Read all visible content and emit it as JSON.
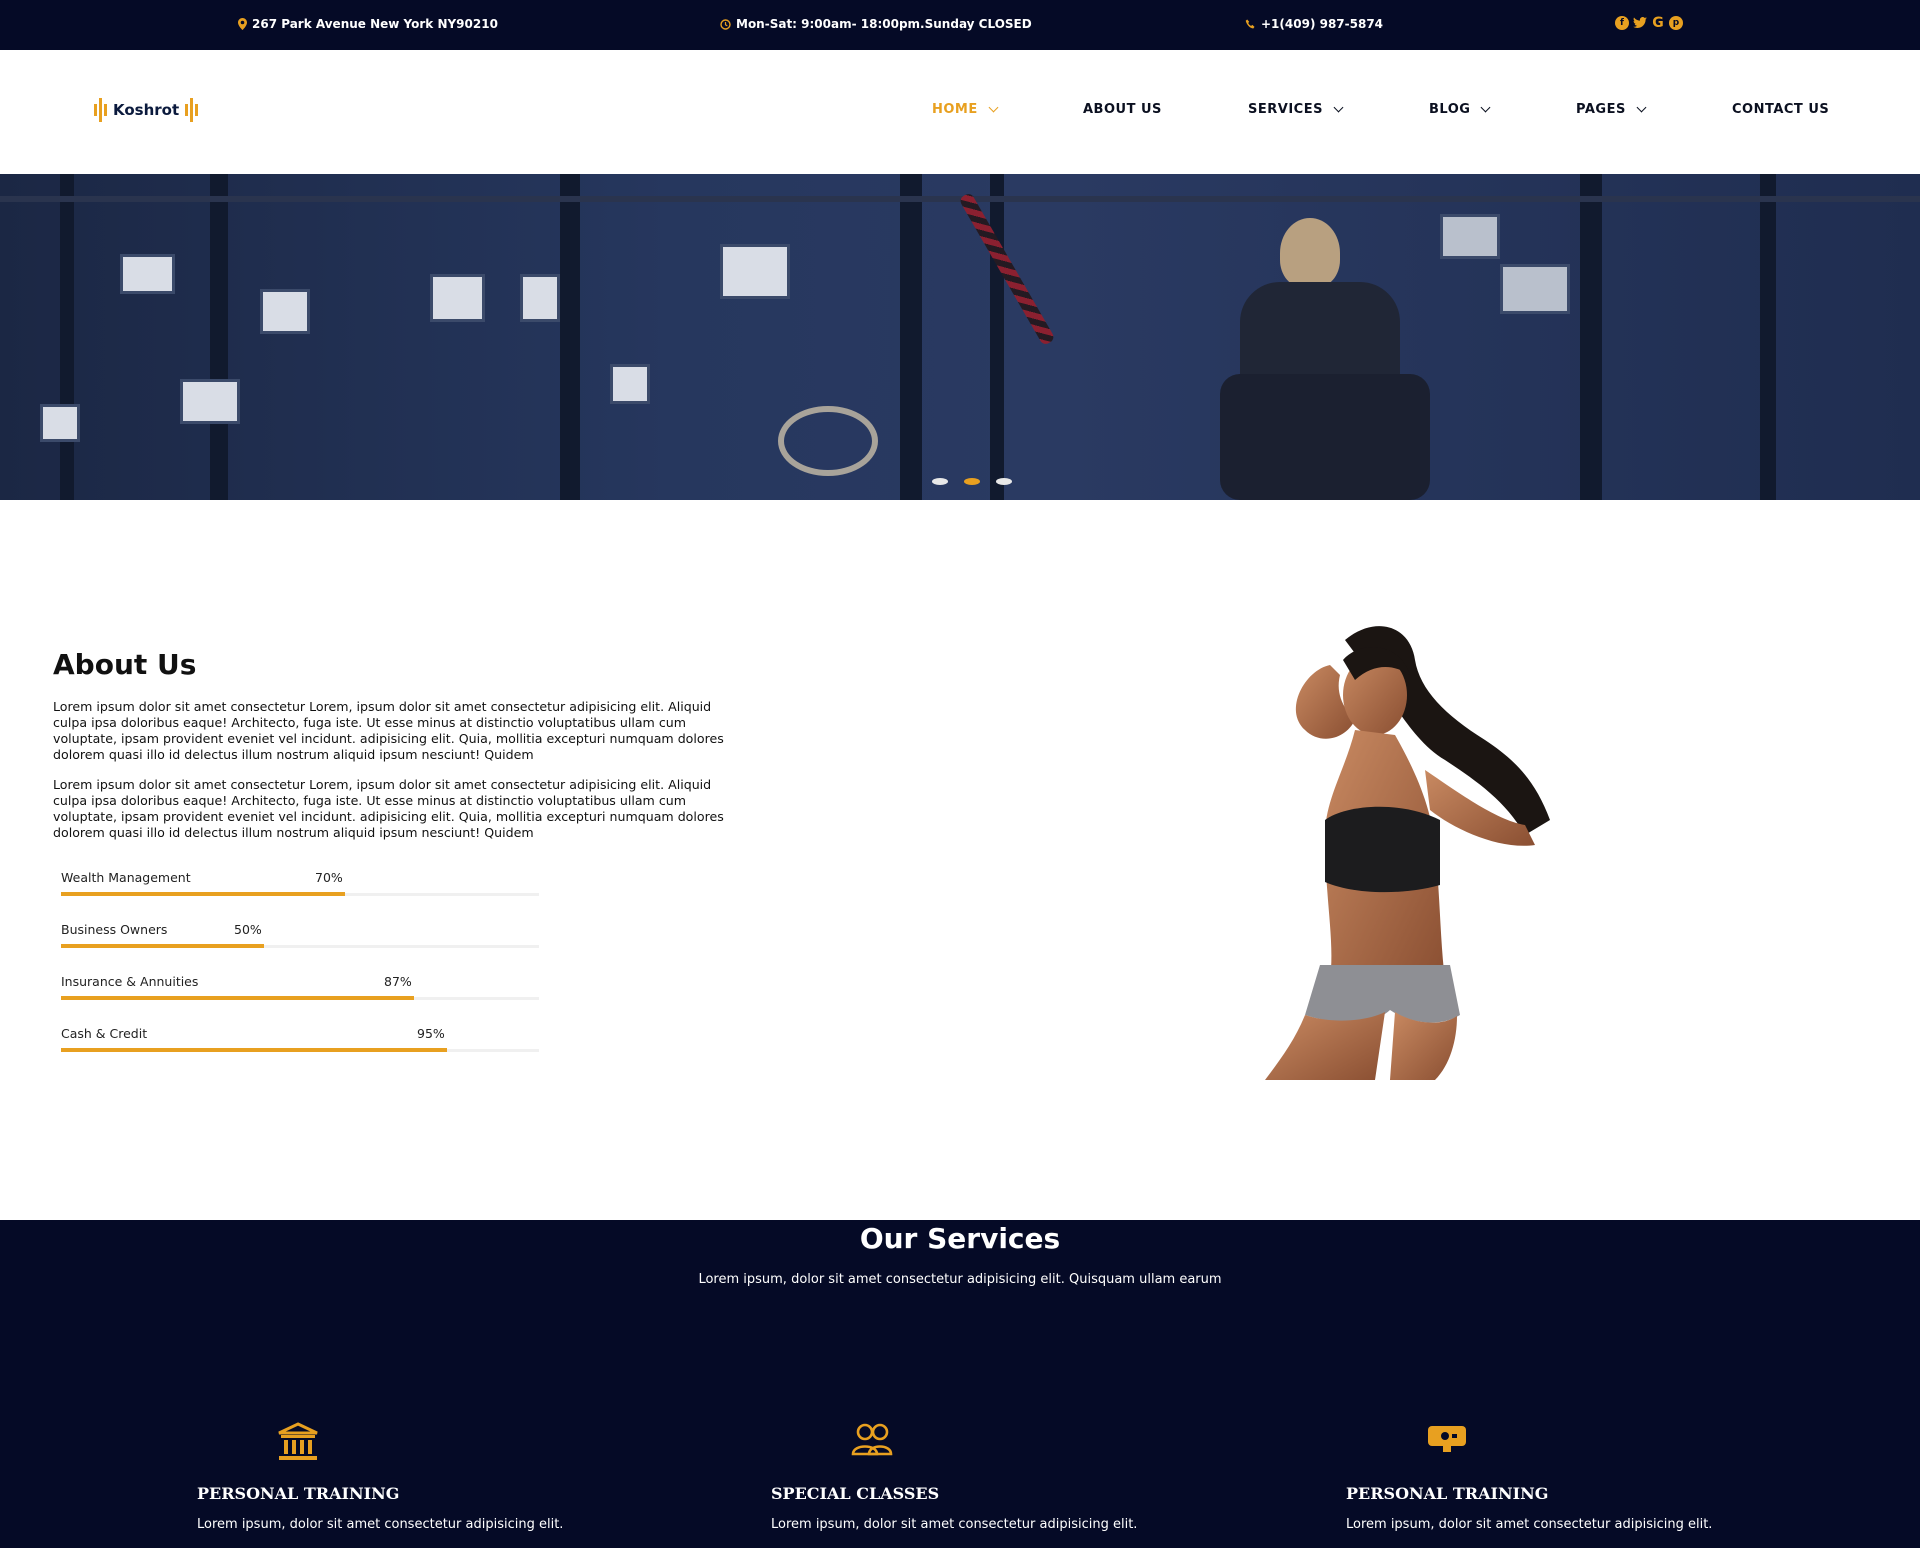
{
  "topbar": {
    "address": "267 Park Avenue New York NY90210",
    "hours": "Mon-Sat: 9:00am- 18:00pm.Sunday CLOSED",
    "phone": "+1(409) 987-5874",
    "social": [
      "facebook-icon",
      "twitter-icon",
      "google-icon",
      "pinterest-icon"
    ]
  },
  "brand": {
    "name": "Koshrot",
    "accent": "#e8a020",
    "dark": "#050a26"
  },
  "nav": {
    "home": "HOME",
    "about": "ABOUT US",
    "services": "SERVICES",
    "blog": "BLOG",
    "pages": "PAGES",
    "contact": "CONTACT US"
  },
  "hero": {
    "slides": 3,
    "active_slide": 2
  },
  "about": {
    "title": "About Us",
    "para1": "Lorem ipsum dolor sit amet consectetur Lorem, ipsum dolor sit amet consectetur adipisicing elit. Aliquid culpa ipsa doloribus eaque! Architecto, fuga iste. Ut esse minus at distinctio voluptatibus ullam cum voluptate, ipsam provident eveniet vel incidunt. adipisicing elit. Quia, mollitia excepturi numquam dolores dolorem quasi illo id delectus illum nostrum aliquid ipsum nesciunt! Quidem",
    "para2": "Lorem ipsum dolor sit amet consectetur Lorem, ipsum dolor sit amet consectetur adipisicing elit. Aliquid culpa ipsa doloribus eaque! Architecto, fuga iste. Ut esse minus at distinctio voluptatibus ullam cum voluptate, ipsam provident eveniet vel incidunt. adipisicing elit. Quia, mollitia excepturi numquam dolores dolorem quasi illo id delectus illum nostrum aliquid ipsum nesciunt! Quidem",
    "skills": [
      {
        "label": "Wealth Management",
        "percent_text": "70%",
        "value": 0.7
      },
      {
        "label": "Business Owners",
        "percent_text": "50%",
        "value": 0.5
      },
      {
        "label": "Insurance & Annuities",
        "percent_text": "87%",
        "value": 0.87
      },
      {
        "label": "Cash & Credit",
        "percent_text": "95%",
        "value": 0.95
      }
    ]
  },
  "services": {
    "title": "Our Services",
    "subtitle": "Lorem ipsum, dolor sit amet consectetur adipisicing elit. Quisquam ullam earum",
    "cards": [
      {
        "icon": "bank-icon",
        "title": "PERSONAL TRAINING",
        "text": "Lorem ipsum, dolor sit amet consectetur adipisicing elit."
      },
      {
        "icon": "users-icon",
        "title": "SPECIAL CLASSES",
        "text": "Lorem ipsum, dolor sit amet consectetur adipisicing elit."
      },
      {
        "icon": "monitor-icon",
        "title": "PERSONAL TRAINING",
        "text": "Lorem ipsum, dolor sit amet consectetur adipisicing elit."
      }
    ]
  }
}
